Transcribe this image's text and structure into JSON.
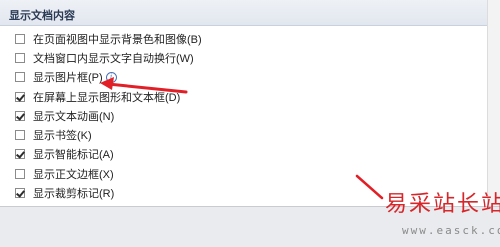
{
  "section": {
    "title": "显示文档内容"
  },
  "options": [
    {
      "label": "在页面视图中显示背景色和图像(B)",
      "checked": false
    },
    {
      "label": "文档窗口内显示文字自动换行(W)",
      "checked": false
    },
    {
      "label": "显示图片框(P)",
      "checked": false,
      "info_icon": "info-icon"
    },
    {
      "label": "在屏幕上显示图形和文本框(D)",
      "checked": true
    },
    {
      "label": "显示文本动画(N)",
      "checked": true
    },
    {
      "label": "显示书签(K)",
      "checked": false
    },
    {
      "label": "显示智能标记(A)",
      "checked": true
    },
    {
      "label": "显示正文边框(X)",
      "checked": false
    },
    {
      "label": "显示裁剪标记(R)",
      "checked": true
    }
  ],
  "watermark": {
    "text": "易采站长站",
    "url": "www.easck.com"
  },
  "colors": {
    "annotation_arrow": "#e21f26",
    "watermark": "#d7262a"
  }
}
